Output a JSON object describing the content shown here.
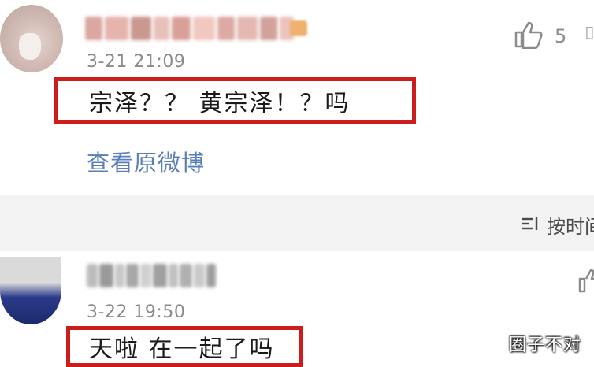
{
  "comments": [
    {
      "timestamp": "3-21 21:09",
      "text": "宗泽？？ 黄宗泽！？吗",
      "likes": "5",
      "view_original": "查看原微博"
    },
    {
      "timestamp": "3-22 19:50",
      "text": "天啦 在一起了吗"
    }
  ],
  "sort": {
    "label": "按时间"
  },
  "watermark": "圈子不对",
  "colors": {
    "highlight_border": "#cc1c1c",
    "link": "#5a7fb8",
    "timestamp": "#8a8a8a",
    "band": "#f3f3f4"
  },
  "icons": [
    "thumbs-up-icon",
    "sort-icon",
    "more-icon"
  ]
}
